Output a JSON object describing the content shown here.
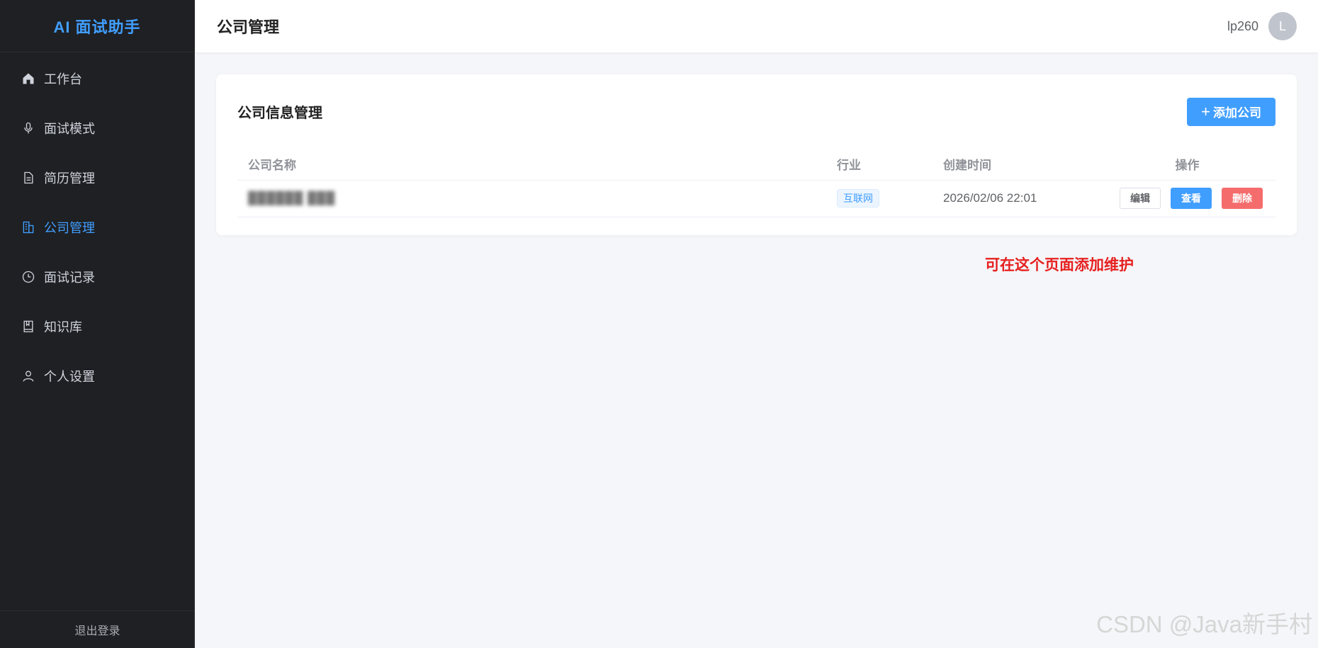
{
  "app": {
    "brand": "AI 面试助手"
  },
  "sidebar": {
    "items": [
      {
        "label": "工作台",
        "icon": "home-icon"
      },
      {
        "label": "面试模式",
        "icon": "microphone-icon"
      },
      {
        "label": "简历管理",
        "icon": "document-icon"
      },
      {
        "label": "公司管理",
        "icon": "building-icon",
        "active": true
      },
      {
        "label": "面试记录",
        "icon": "clock-icon"
      },
      {
        "label": "知识库",
        "icon": "book-icon"
      },
      {
        "label": "个人设置",
        "icon": "user-icon"
      }
    ],
    "logout": "退出登录"
  },
  "header": {
    "title": "公司管理",
    "username": "lp260",
    "avatar_letter": "L"
  },
  "card": {
    "title": "公司信息管理",
    "add_button": "添加公司",
    "add_button_icon": "+"
  },
  "table": {
    "columns": [
      "公司名称",
      "行业",
      "创建时间",
      "操作"
    ],
    "rows": [
      {
        "name": "██████ ███",
        "industry": "互联网",
        "created": "2026/02/06 22:01",
        "actions": [
          "编辑",
          "查看",
          "删除"
        ]
      }
    ]
  },
  "annotation": "可在这个页面添加维护",
  "watermark": "CSDN @Java新手村",
  "colors": {
    "accent": "#409eff",
    "danger": "#f56c6c",
    "sidebar_bg": "#1f2023",
    "annotation": "#e62020"
  }
}
